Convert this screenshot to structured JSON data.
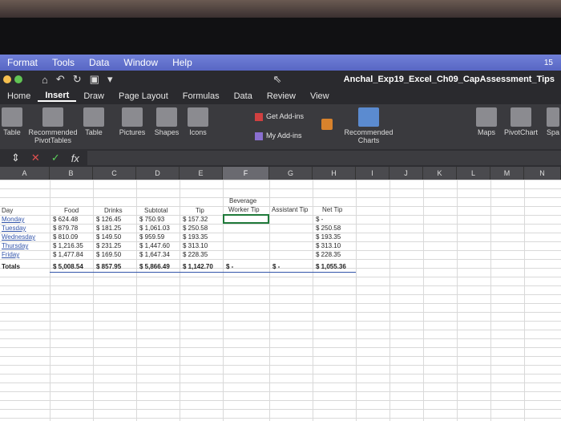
{
  "menubar": {
    "items": [
      "Format",
      "Tools",
      "Data",
      "Window",
      "Help"
    ],
    "right_indicator": "15"
  },
  "titlebar": {
    "doc_title": "Anchal_Exp19_Excel_Ch09_CapAssessment_Tips",
    "icons": [
      "home-icon",
      "undo-icon",
      "redo-icon",
      "save-icon",
      "customize-icon"
    ]
  },
  "tabs": [
    "Home",
    "Insert",
    "Draw",
    "Page Layout",
    "Formulas",
    "Data",
    "Review",
    "View"
  ],
  "active_tab": "Insert",
  "ribbon": {
    "groups": [
      "Table",
      "Recommended PivotTables",
      "Table",
      "Pictures",
      "Shapes",
      "Icons",
      "Recommended Charts",
      "Maps",
      "PivotChart",
      "Spa"
    ],
    "get_addins": "Get Add-ins",
    "my_addins": "My Add-ins"
  },
  "formulabar": {
    "fx": "fx",
    "value": ""
  },
  "columns": [
    "A",
    "B",
    "C",
    "D",
    "E",
    "F",
    "G",
    "H",
    "I",
    "J",
    "K",
    "L",
    "M",
    "N"
  ],
  "selected_column": "F",
  "sheet": {
    "headers": {
      "day": "Day",
      "food": "Food",
      "drinks": "Drinks",
      "subtotal": "Subtotal",
      "tip": "Tip",
      "beverage1": "Beverage",
      "beverage2": "Worker Tip",
      "assistant": "Assistant Tip",
      "net": "Net Tip"
    },
    "rows": [
      {
        "day": "Monday",
        "food": "$    624.48",
        "drinks": "$    126.45",
        "subtotal": "$    750.93",
        "tip": "$    157.32",
        "net": "$          -"
      },
      {
        "day": "Tuesday",
        "food": "$    879.78",
        "drinks": "$    181.25",
        "subtotal": "$ 1,061.03",
        "tip": "$    250.58",
        "net": "$     250.58"
      },
      {
        "day": "Wednesday",
        "food": "$    810.09",
        "drinks": "$    149.50",
        "subtotal": "$    959.59",
        "tip": "$    193.35",
        "net": "$     193.35"
      },
      {
        "day": "Thursday",
        "food": "$ 1,216.35",
        "drinks": "$    231.25",
        "subtotal": "$ 1,447.60",
        "tip": "$    313.10",
        "net": "$     313.10"
      },
      {
        "day": "Friday",
        "food": "$ 1,477.84",
        "drinks": "$    169.50",
        "subtotal": "$ 1,647.34",
        "tip": "$    228.35",
        "net": "$     228.35"
      }
    ],
    "totals": {
      "day": "Totals",
      "food": "$ 5,008.54",
      "drinks": "$    857.95",
      "subtotal": "$ 5,866.49",
      "tip": "$ 1,142.70",
      "beverage": "$          -",
      "assistant": "$          -",
      "net": "$ 1,055.36"
    }
  },
  "colors": {
    "accent": "#5866c4",
    "selection": "#1f7a3a"
  }
}
